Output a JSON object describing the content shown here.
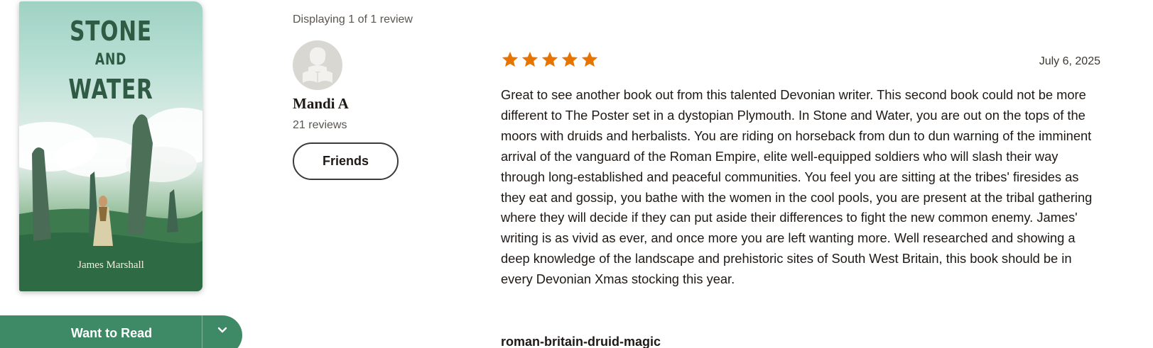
{
  "book": {
    "cover_title_line1": "STONE",
    "cover_title_line2": "AND",
    "cover_title_line3": "WATER",
    "cover_author": "James Marshall"
  },
  "shelf_button": {
    "label": "Want to Read",
    "dropdown_icon": "chevron-down-icon",
    "color": "#3f8a66"
  },
  "reviews_header": {
    "displaying_text": "Displaying 1 of 1 review"
  },
  "review": {
    "reviewer_name": "Mandi A",
    "reviewer_review_count": "21 reviews",
    "friends_button_label": "Friends",
    "rating": 5,
    "max_rating": 5,
    "star_color": "#e87400",
    "date": "July 6, 2025",
    "text": "Great to see another book out from this talented Devonian writer. This second book could not be more different to The Poster set in a dystopian Plymouth. In Stone and Water, you are out on the tops of the moors with druids and herbalists. You are riding on horseback from dun to dun warning of the imminent arrival of the vanguard of the Roman Empire, elite well-equipped soldiers who will slash their way through long-established and peaceful communities. You feel you are sitting at the tribes' firesides as they eat and gossip, you bathe with the women in the cool pools, you are present at the tribal gathering where they will decide if they can put aside their differences to fight the new common enemy. James' writing is as vivid as ever, and once more you are left wanting more. Well researched and showing a deep knowledge of the landscape and prehistoric sites of South West Britain, this book should be in every Devonian Xmas stocking this year.",
    "shelf": "roman-britain-druid-magic"
  }
}
